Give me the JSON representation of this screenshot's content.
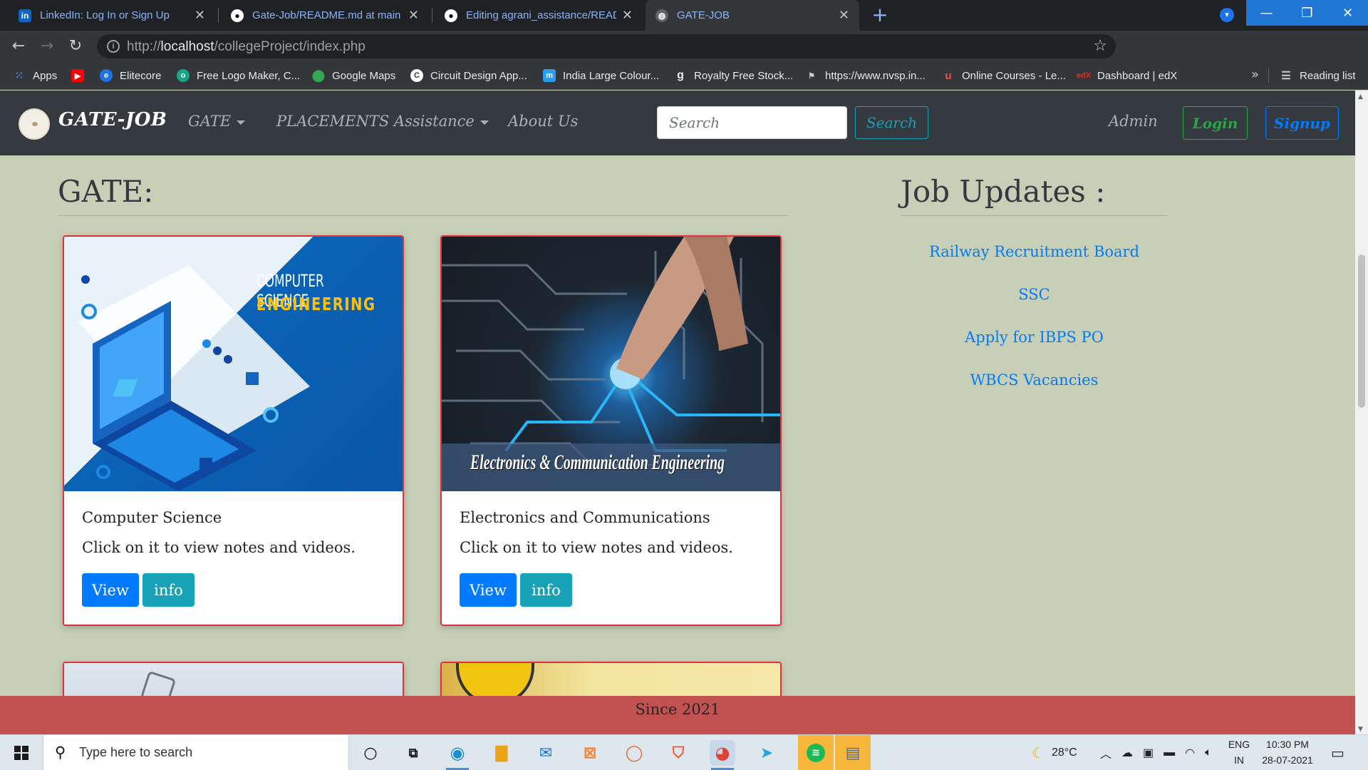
{
  "browser": {
    "tabs": [
      {
        "title": "LinkedIn: Log In or Sign Up",
        "favicon": "in",
        "color": "#0a66c2",
        "style": "link"
      },
      {
        "title": "Gate-Job/README.md at main · ",
        "favicon": "gh",
        "color": "#ffffff",
        "style": "plain"
      },
      {
        "title": "Editing agrani_assistance/README",
        "favicon": "gh",
        "color": "#ffffff",
        "style": "link"
      },
      {
        "title": "GATE-JOB",
        "favicon": "globe",
        "color": "#9aa0a6",
        "style": "active"
      }
    ],
    "url_prefix": "http://",
    "url_host": "localhost",
    "url_path": "/collegeProject/index.php",
    "bookmarks": [
      {
        "label": "Apps",
        "icon": "apps-grid"
      },
      {
        "label": "",
        "icon": "youtube"
      },
      {
        "label": "Elitecore",
        "icon": "elitecore"
      },
      {
        "label": "Free Logo Maker, C...",
        "icon": "logo-maker"
      },
      {
        "label": "Google Maps",
        "icon": "maps-pin"
      },
      {
        "label": "Circuit Design App...",
        "icon": "circuit"
      },
      {
        "label": "India Large Colour...",
        "icon": "m-logo"
      },
      {
        "label": "Royalty Free Stock...",
        "icon": "g-logo"
      },
      {
        "label": "https://www.nvsp.in...",
        "icon": "nvsp"
      },
      {
        "label": "Online Courses - Le...",
        "icon": "udemy"
      },
      {
        "label": "Dashboard | edX",
        "icon": "edx"
      }
    ],
    "bookmarks_more": "»",
    "reading_list": "Reading list"
  },
  "site": {
    "brand": "GATE-JOB",
    "nav": {
      "gate": "GATE",
      "placements": "PLACEMENTS Assistance",
      "about": "About Us"
    },
    "search": {
      "placeholder": "Search",
      "button": "Search"
    },
    "admin": "Admin",
    "login": "Login",
    "signup": "Signup"
  },
  "gate_section": {
    "heading": "GATE:",
    "cards": [
      {
        "image_title_line1": "COMPUTER SCIENCE",
        "image_title_line2": "ENGINEERING",
        "title": "Computer Science",
        "text": "Click on it to view notes and videos.",
        "view": "View",
        "info": "info"
      },
      {
        "image_title": "Electronics & Communication Engineering",
        "title": "Electronics and Communications",
        "text": "Click on it to view notes and videos.",
        "view": "View",
        "info": "info"
      }
    ]
  },
  "jobs_section": {
    "heading": "Job Updates :",
    "links": [
      "Railway Recruitment Board",
      "SSC",
      "Apply for IBPS PO",
      "WBCS Vacancies"
    ]
  },
  "footer": {
    "text": "Since 2021"
  },
  "taskbar": {
    "search_placeholder": "Type here to search",
    "weather": "28°C",
    "lang_top": "ENG",
    "lang_bottom": "IN",
    "time": "10:30 PM",
    "date": "28-07-2021"
  }
}
